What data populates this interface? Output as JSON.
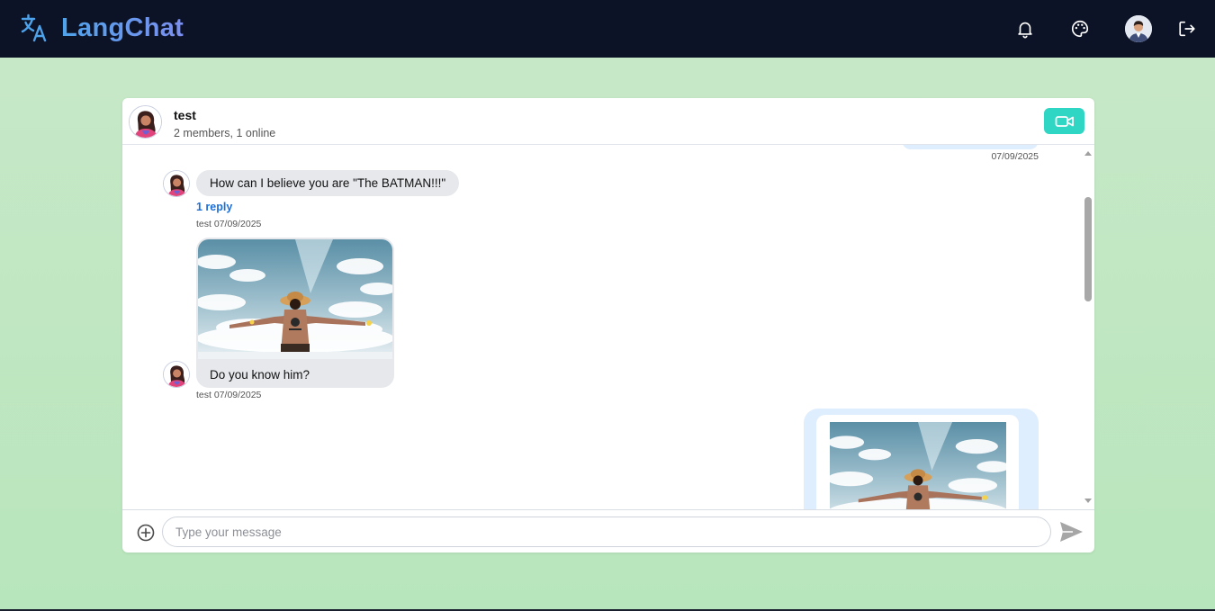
{
  "app": {
    "brand": "LangChat",
    "colors": {
      "navbar": "#0d1326",
      "brand_accent": "#4fa3ea",
      "video_button": "#2fd6c3",
      "link": "#1d6fd6"
    },
    "nav_icons": [
      "bell-icon",
      "palette-icon",
      "user-avatar",
      "logout-icon"
    ]
  },
  "channel": {
    "name": "test",
    "meta": "2 members, 1 online"
  },
  "messages": {
    "prev_timestamp": "07/09/2025",
    "first": {
      "text": "How can I believe you are \"The BATMAN!!!\"",
      "reply_link": "1 reply",
      "meta": "test 07/09/2025"
    },
    "second": {
      "caption": "Do you know him?",
      "meta": "test 07/09/2025"
    }
  },
  "composer": {
    "placeholder": "Type your message"
  }
}
